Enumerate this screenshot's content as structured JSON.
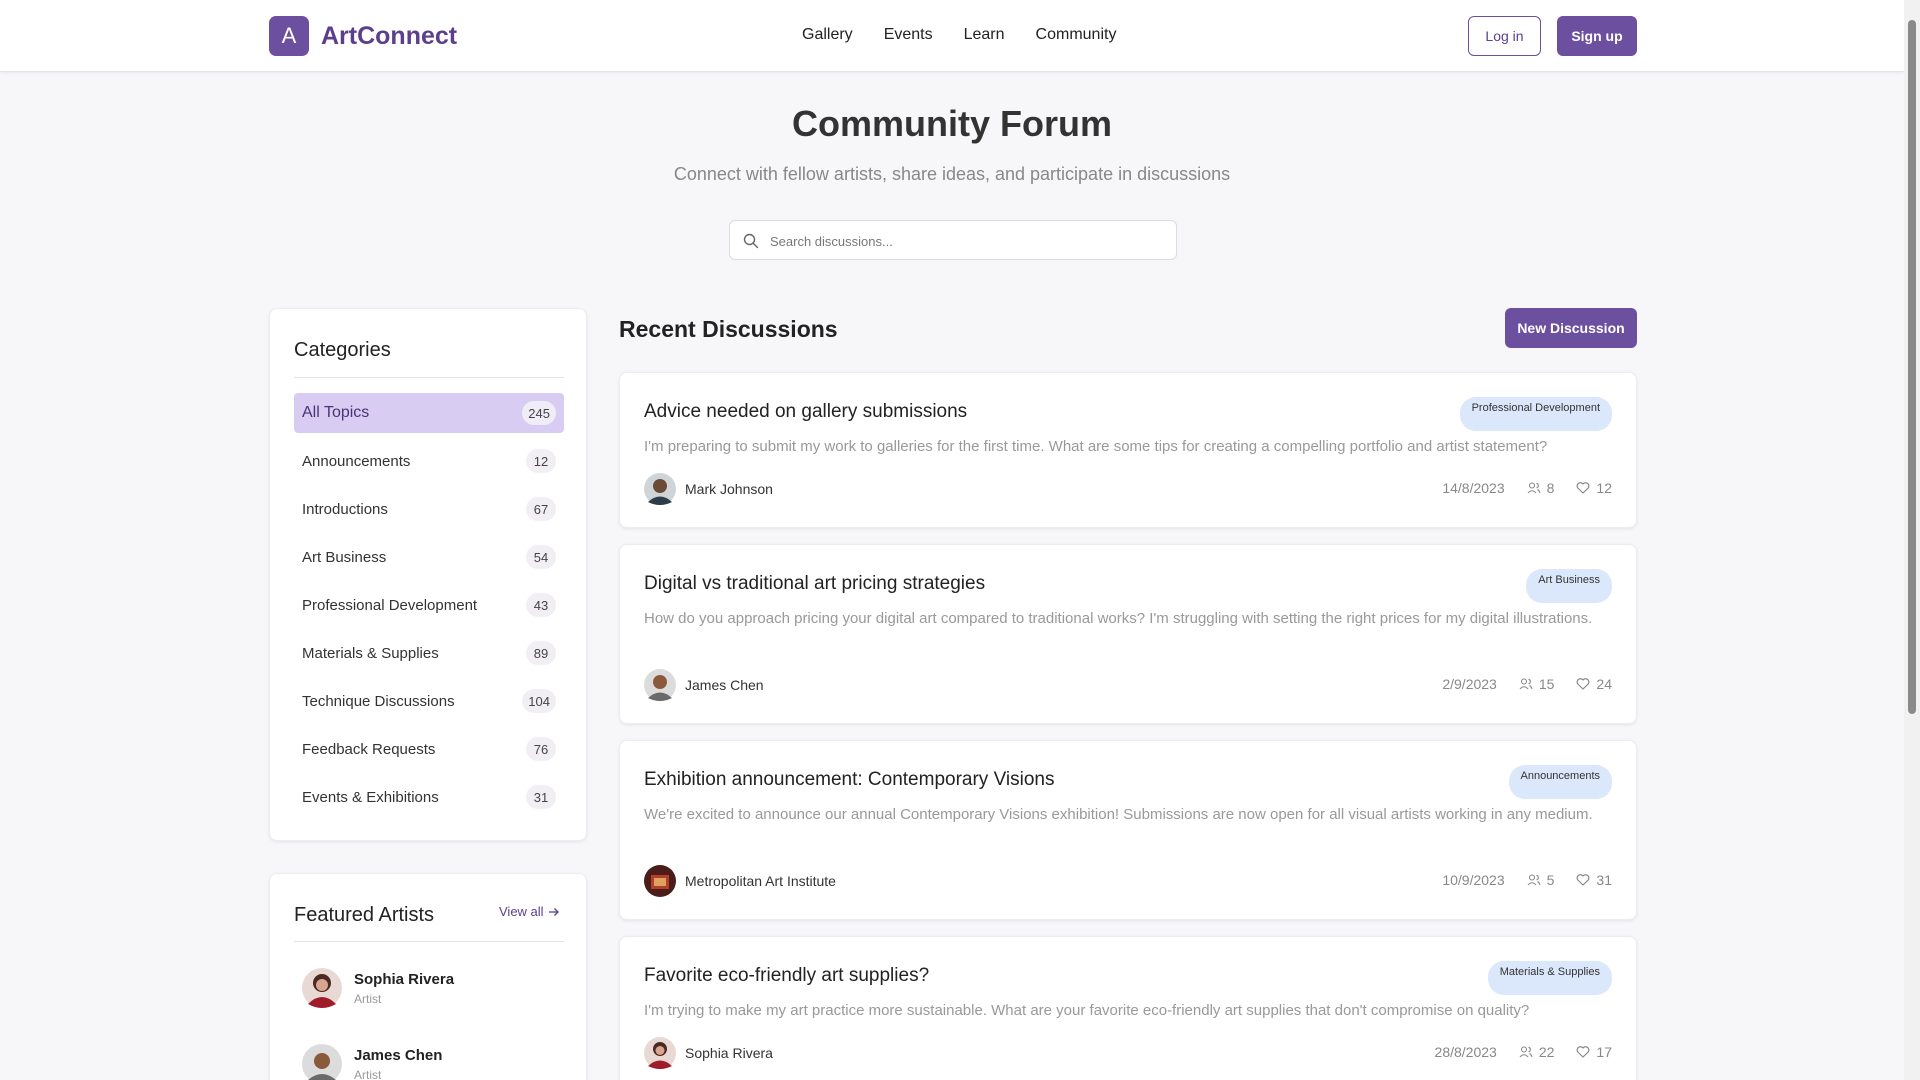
{
  "header": {
    "logo_letter": "A",
    "brand": "ArtConnect",
    "nav": [
      "Gallery",
      "Events",
      "Learn",
      "Community"
    ],
    "login_label": "Log in",
    "signup_label": "Sign up"
  },
  "hero": {
    "title": "Community Forum",
    "subtitle": "Connect with fellow artists, share ideas, and participate in discussions",
    "search_placeholder": "Search discussions..."
  },
  "categories": {
    "title": "Categories",
    "items": [
      {
        "label": "All Topics",
        "count": "245"
      },
      {
        "label": "Announcements",
        "count": "12"
      },
      {
        "label": "Introductions",
        "count": "67"
      },
      {
        "label": "Art Business",
        "count": "54"
      },
      {
        "label": "Professional Development",
        "count": "43"
      },
      {
        "label": "Materials & Supplies",
        "count": "89"
      },
      {
        "label": "Technique Discussions",
        "count": "104"
      },
      {
        "label": "Feedback Requests",
        "count": "76"
      },
      {
        "label": "Events & Exhibitions",
        "count": "31"
      }
    ]
  },
  "featured": {
    "title": "Featured Artists",
    "view_all": "View all",
    "artists": [
      {
        "name": "Sophia Rivera",
        "role": "Artist"
      },
      {
        "name": "James Chen",
        "role": "Artist"
      }
    ]
  },
  "discussions": {
    "title": "Recent Discussions",
    "new_label": "New Discussion",
    "posts": [
      {
        "title": "Advice needed on gallery submissions",
        "tag": "Professional Development",
        "excerpt": "I'm preparing to submit my work to galleries for the first time. What are some tips for creating a compelling portfolio and artist statement?",
        "author": "Mark Johnson",
        "date": "14/8/2023",
        "members": "8",
        "likes": "12"
      },
      {
        "title": "Digital vs traditional art pricing strategies",
        "tag": "Art Business",
        "excerpt": "How do you approach pricing your digital art compared to traditional works? I'm struggling with setting the right prices for my digital illustrations.",
        "author": "James Chen",
        "date": "2/9/2023",
        "members": "15",
        "likes": "24"
      },
      {
        "title": "Exhibition announcement: Contemporary Visions",
        "tag": "Announcements",
        "excerpt": "We're excited to announce our annual Contemporary Visions exhibition! Submissions are now open for all visual artists working in any medium.",
        "author": "Metropolitan Art Institute",
        "date": "10/9/2023",
        "members": "5",
        "likes": "31"
      },
      {
        "title": "Favorite eco-friendly art supplies?",
        "tag": "Materials & Supplies",
        "excerpt": "I'm trying to make my art practice more sustainable. What are your favorite eco-friendly art supplies that don't compromise on quality?",
        "author": "Sophia Rivera",
        "date": "28/8/2023",
        "members": "22",
        "likes": "17"
      }
    ]
  },
  "colors": {
    "brand": "#6d4fa0",
    "active_category": "#d9ccf3",
    "tag_bg": "#dbe8fb"
  }
}
